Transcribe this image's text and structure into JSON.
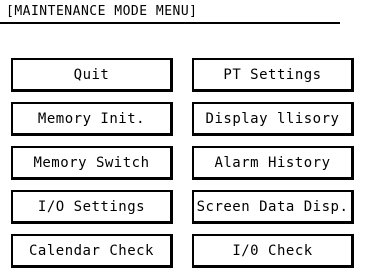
{
  "title": "[MAINTENANCE MODE MENU]",
  "menu": {
    "left": [
      "Quit",
      "Memory Init.",
      "Memory Switch",
      "I/O Settings",
      "Calendar Check"
    ],
    "right": [
      "PT Settings",
      "Display llisory",
      "Alarm History",
      "Screen Data Disp.",
      "I/0 Check"
    ]
  }
}
